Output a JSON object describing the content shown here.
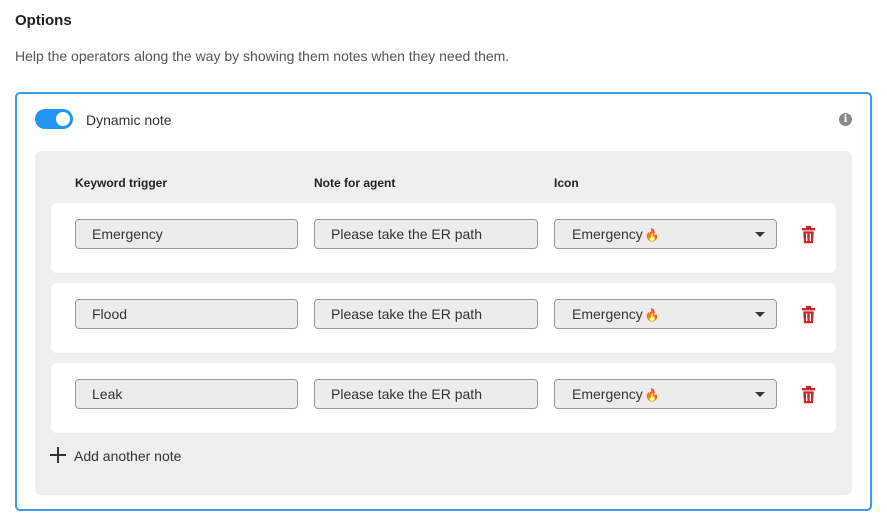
{
  "header": {
    "title": "Options",
    "description": "Help the operators along the way by showing them notes when they need them."
  },
  "dynamic_note": {
    "label": "Dynamic note",
    "enabled": true,
    "info_icon": "info-icon",
    "accent_color": "#2196f3"
  },
  "table": {
    "columns": {
      "keyword": "Keyword trigger",
      "note": "Note for agent",
      "icon": "Icon"
    },
    "rows": [
      {
        "keyword": "Emergency",
        "note": "Please take the ER path",
        "icon_label": "Emergency",
        "icon_glyph": "🔥"
      },
      {
        "keyword": "Flood",
        "note": "Please take the ER path",
        "icon_label": "Emergency",
        "icon_glyph": "🔥"
      },
      {
        "keyword": "Leak",
        "note": "Please take the ER path",
        "icon_label": "Emergency",
        "icon_glyph": "🔥"
      }
    ],
    "delete_icon": "trash-icon",
    "delete_color": "#c62828"
  },
  "add_note": {
    "label": "Add another note",
    "icon": "plus-icon"
  }
}
